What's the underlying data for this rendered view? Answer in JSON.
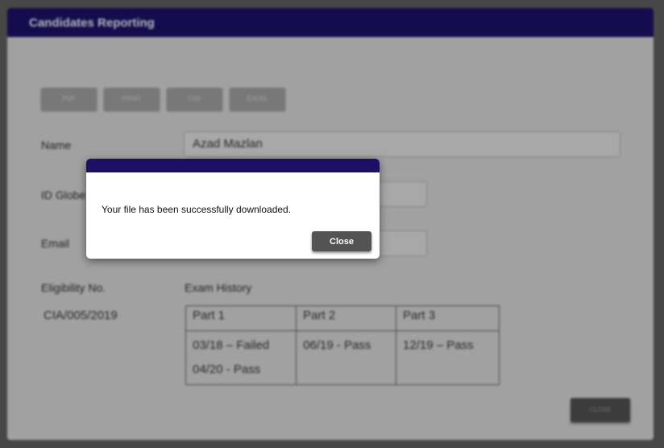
{
  "window": {
    "title": "Candidates Reporting"
  },
  "export_buttons": [
    "PDF",
    "PRINT",
    "CSV",
    "EXCEL"
  ],
  "form": {
    "name_label": "Name",
    "name_value": "Azad Mazlan",
    "id_label": "ID Globe",
    "id_value": "",
    "email_label": "Email",
    "email_value": "",
    "eligibility_label": "Eligibility No.",
    "eligibility_value": "CIA/005/2019",
    "exam_history_label": "Exam History"
  },
  "exam_history": {
    "headers": [
      "Part 1",
      "Part 2",
      "Part 3"
    ],
    "part1": [
      "03/18 – Failed",
      "04/20 - Pass"
    ],
    "part2": [
      "06/19 - Pass"
    ],
    "part3": [
      "12/19 – Pass"
    ]
  },
  "close_label": "CLOSE",
  "modal": {
    "message": "Your file has been successfully downloaded.",
    "close_label": "Close"
  },
  "colors": {
    "title_bar": "#1b1064",
    "dim_overlay": "rgba(0,0,0,0.22)"
  }
}
